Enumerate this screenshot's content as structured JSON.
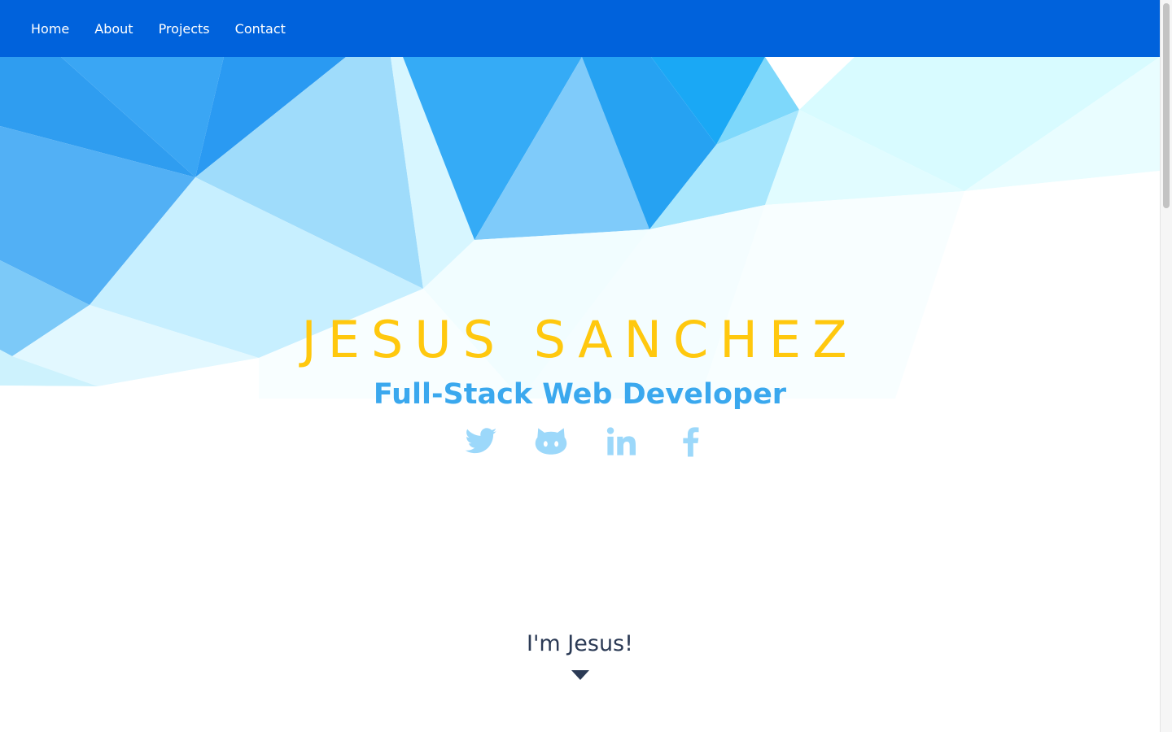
{
  "nav": {
    "items": [
      {
        "label": "Home"
      },
      {
        "label": "About"
      },
      {
        "label": "Projects"
      },
      {
        "label": "Contact"
      }
    ]
  },
  "hero": {
    "name": "JESUS SANCHEZ",
    "subtitle": "Full-Stack Web Developer",
    "social": [
      {
        "icon": "twitter-icon"
      },
      {
        "icon": "github-icon"
      },
      {
        "icon": "linkedin-icon"
      },
      {
        "icon": "facebook-icon"
      }
    ]
  },
  "intro": {
    "text": "I'm Jesus!",
    "caret_icon": "caret-down-icon"
  },
  "colors": {
    "nav_bg": "#0062DC",
    "name": "#FFC80E",
    "subtitle": "#3AA8EE",
    "social_icons": "#9CD8FA",
    "intro_text": "#2B3A55"
  }
}
